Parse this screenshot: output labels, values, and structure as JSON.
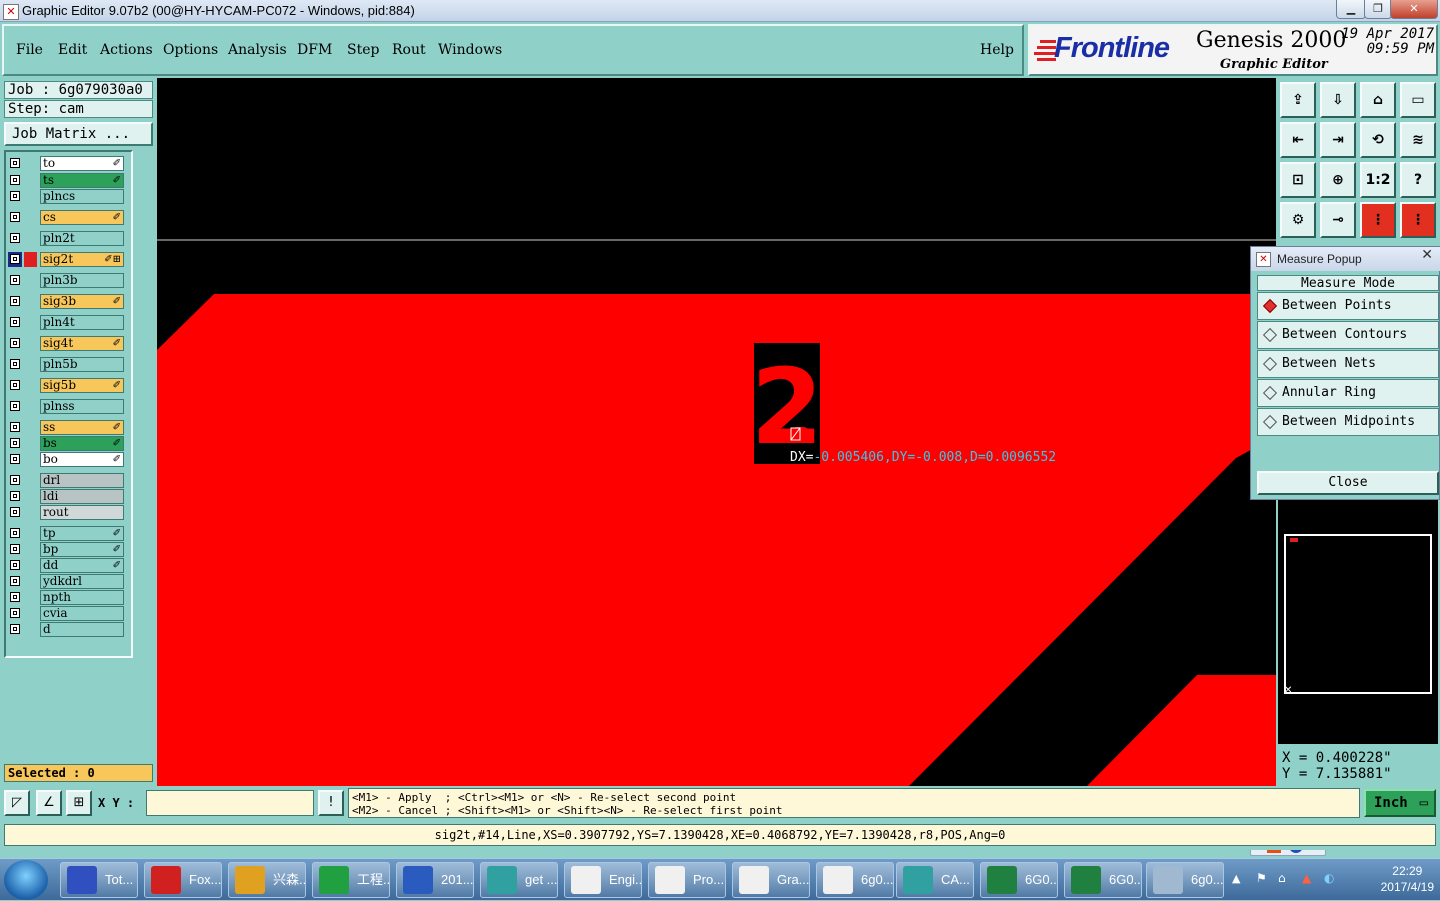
{
  "window": {
    "title": "Graphic Editor 9.07b2 (00@HY-HYCAM-PC072 - Windows, pid:884)"
  },
  "menu": {
    "items": [
      "File",
      "Edit",
      "Actions",
      "Options",
      "Analysis",
      "DFM",
      "Step",
      "Rout",
      "Windows"
    ],
    "help": "Help"
  },
  "brand": {
    "logo": "Frontline",
    "product": "Genesis 2000",
    "subtitle": "Graphic Editor",
    "date": "19 Apr 2017",
    "time": "09:59 PM"
  },
  "job": {
    "job_line": "Job : 6g079030a0",
    "step_line": "Step: cam",
    "matrix_button": "Job Matrix ..."
  },
  "layers": [
    {
      "name": "to",
      "color": "#ffffff",
      "mark": "✐"
    },
    {
      "name": "ts",
      "color": "#2da15a",
      "mark": "✐"
    },
    {
      "name": "plncs",
      "color": "#8fd0c8",
      "mark": ""
    },
    {
      "name": "cs",
      "color": "#f7c75c",
      "mark": "✐"
    },
    {
      "name": "pln2t",
      "color": "#8fd0c8",
      "mark": ""
    },
    {
      "name": "sig2t",
      "color": "#f7c75c",
      "mark": "✐⊞"
    },
    {
      "name": "pln3b",
      "color": "#8fd0c8",
      "mark": ""
    },
    {
      "name": "sig3b",
      "color": "#f7c75c",
      "mark": "✐"
    },
    {
      "name": "pln4t",
      "color": "#8fd0c8",
      "mark": ""
    },
    {
      "name": "sig4t",
      "color": "#f7c75c",
      "mark": "✐"
    },
    {
      "name": "pln5b",
      "color": "#8fd0c8",
      "mark": ""
    },
    {
      "name": "sig5b",
      "color": "#f7c75c",
      "mark": "✐"
    },
    {
      "name": "plnss",
      "color": "#8fd0c8",
      "mark": ""
    },
    {
      "name": "ss",
      "color": "#f7c75c",
      "mark": "✐"
    },
    {
      "name": "bs",
      "color": "#2da15a",
      "mark": "✐"
    },
    {
      "name": "bo",
      "color": "#ffffff",
      "mark": "✐"
    },
    {
      "name": "drl",
      "color": "#b8c4c4",
      "mark": ""
    },
    {
      "name": "ldi",
      "color": "#b8c4c4",
      "mark": ""
    },
    {
      "name": "rout",
      "color": "#d0d8d8",
      "mark": ""
    },
    {
      "name": "tp",
      "color": "#8fd0c8",
      "mark": "✐"
    },
    {
      "name": "bp",
      "color": "#8fd0c8",
      "mark": "✐"
    },
    {
      "name": "dd",
      "color": "#8fd0c8",
      "mark": "✐"
    },
    {
      "name": "ydkdrl",
      "color": "#8fd0c8",
      "mark": ""
    },
    {
      "name": "npth",
      "color": "#8fd0c8",
      "mark": ""
    },
    {
      "name": "cvia",
      "color": "#8fd0c8",
      "mark": ""
    },
    {
      "name": "d",
      "color": "#8fd0c8",
      "mark": ""
    }
  ],
  "selected_text": "Selected : 0",
  "canvas": {
    "label_glyph": "2",
    "measure": {
      "dx_label": "DX=",
      "value": "-0.005406,DY=-0.008,D=0.0096552"
    }
  },
  "tools": [
    "⇪",
    "⇩",
    "⌂",
    "▭",
    "⇤",
    "⇥",
    "⟲",
    "≋",
    "⊡",
    "⊕",
    "1:2",
    "?",
    "⚙",
    "⊸",
    "⋮",
    "⋮"
  ],
  "popup": {
    "title": "Measure Popup",
    "header": "Measure Mode",
    "options": [
      "Between Points",
      "Between Contours",
      "Between Nets",
      "Annular Ring",
      "Between Midpoints"
    ],
    "close": "Close"
  },
  "coords": {
    "x": "X = 0.400228\"",
    "y": "Y = 7.135881\""
  },
  "cmd": {
    "xy_label": "X Y :",
    "alert": "!",
    "hint_line1": "<M1> - Apply  ; <Ctrl><M1> or <N> - Re-select second point",
    "hint_line2": "<M2> - Cancel ; <Shift><M1> or <Shift><N> - Re-select first point",
    "unit": "Inch"
  },
  "info_line": "sig2t,#14,Line,XS=0.3907792,YS=7.1390428,XE=0.4068792,YE=7.1390428,r8,POS,Ang=0",
  "taskbar": {
    "tasks": [
      {
        "label": "Tot...",
        "color": "#3050c0"
      },
      {
        "label": "Fox...",
        "color": "#d02020"
      },
      {
        "label": "兴森...",
        "color": "#e0a020"
      },
      {
        "label": "工程...",
        "color": "#20a040"
      },
      {
        "label": "201...",
        "color": "#2a5cc0"
      },
      {
        "label": "get ...",
        "color": "#30a0a0"
      },
      {
        "label": "Engi...",
        "color": "#f0f0f0"
      },
      {
        "label": "Pro...",
        "color": "#f0f0f0"
      },
      {
        "label": "Gra...",
        "color": "#f0f0f0"
      },
      {
        "label": "6g0...",
        "color": "#f0f0f0"
      },
      {
        "label": "CA...",
        "color": "#30a0a0"
      },
      {
        "label": "6G0...",
        "color": "#208040"
      },
      {
        "label": "6G0...",
        "color": "#208040"
      },
      {
        "label": "6g0...",
        "color": "#a0b8d0"
      }
    ],
    "time": "22:29",
    "date": "2017/4/19"
  },
  "colors": {
    "canvas_bg": "#000000",
    "copper": "#ff0000",
    "measure_text": "#35c8e8",
    "panel": "#8fd0c8"
  }
}
